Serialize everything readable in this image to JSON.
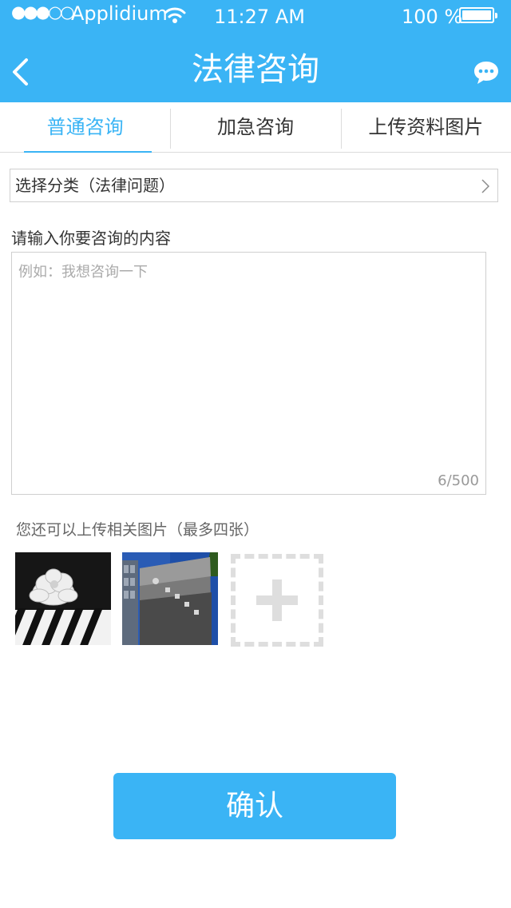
{
  "status_bar": {
    "signal": "●●●○○",
    "carrier": "Applidium",
    "time": "11:27 AM",
    "battery": "100 %"
  },
  "header": {
    "title": "法律咨询",
    "back_icon": "chevron-left-icon",
    "chat_icon": "chat-bubble-icon"
  },
  "tabs": [
    {
      "label": "普通咨询",
      "active": true
    },
    {
      "label": "加急咨询",
      "active": false
    },
    {
      "label": "上传资料图片",
      "active": false
    }
  ],
  "category": {
    "label": "选择分类（法律问题）"
  },
  "consult": {
    "label": "请输入你要咨询的内容",
    "placeholder": "例如：我想咨询一下",
    "counter": "6/500"
  },
  "upload": {
    "hint": "您还可以上传相关图片（最多四张）"
  },
  "confirm_label": "确认",
  "colors": {
    "accent": "#3ab4f5",
    "border": "#cfcfcf",
    "placeholder": "#aaaaaa"
  }
}
